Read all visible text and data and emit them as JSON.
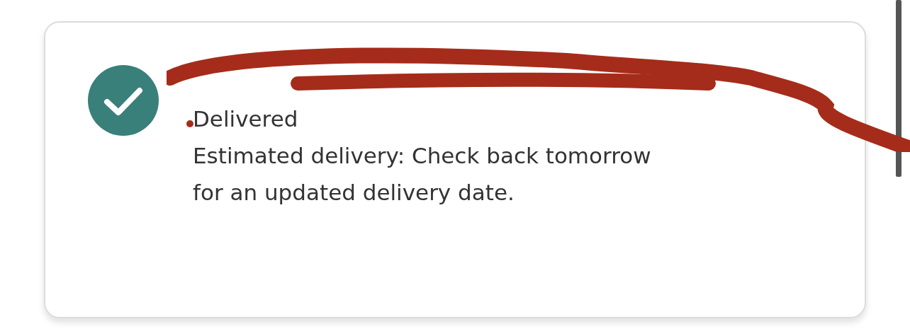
{
  "delivery_card": {
    "status": {
      "kind": "delivered",
      "label": "Delivered"
    },
    "estimate": "Estimated delivery: Check back tomorrow for an updated delivery date."
  }
}
